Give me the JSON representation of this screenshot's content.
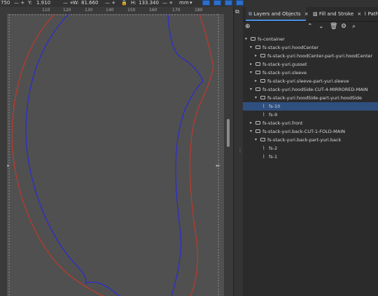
{
  "toolbar": {
    "x_fragment": "750",
    "y_label": "Y:",
    "y_value": "1.910",
    "w_label": "W:",
    "w_value": "81.660",
    "h_label": "H:",
    "h_value": "133.340",
    "unit": "mm"
  },
  "ruler": {
    "ticks": [
      "110",
      "120",
      "130",
      "140",
      "150",
      "160",
      "170",
      "180"
    ]
  },
  "panel": {
    "tabs": [
      {
        "label": "Layers and Objects",
        "close": "×"
      },
      {
        "label": "Fill and Stroke",
        "close": "×"
      },
      {
        "label": "Path"
      }
    ]
  },
  "layers": [
    {
      "label": "fs-container",
      "kind": "folder",
      "caret": "▾"
    },
    {
      "label": "fs-stack-yuri.hoodCenter",
      "kind": "folder",
      "caret": "▾"
    },
    {
      "label": "fs-stack-yuri.hoodCenter-part-yuri.hoodCenter",
      "kind": "folder",
      "caret": "▸"
    },
    {
      "label": "fs-stack-yuri.gusset",
      "kind": "folder",
      "caret": "▸"
    },
    {
      "label": "fs-stack-yuri.sleeve",
      "kind": "folder",
      "caret": "▾"
    },
    {
      "label": "fs-stack-yuri.sleeve-part-yuri.sleeve",
      "kind": "folder",
      "caret": "▸"
    },
    {
      "label": "fs-stack-yuri.hoodSide-CUT-4-MIRRORED-MAIN",
      "kind": "folder",
      "caret": "▾"
    },
    {
      "label": "fs-stack-yuri.hoodSide-part-yuri.hoodSide",
      "kind": "folder",
      "caret": "▾"
    },
    {
      "label": "fs-10",
      "kind": "path",
      "selected": true
    },
    {
      "label": "fs-9",
      "kind": "path"
    },
    {
      "label": "fs-stack-yuri.front",
      "kind": "folder",
      "caret": "▸"
    },
    {
      "label": "fs-stack-yuri.back-CUT-1-FOLD-MAIN",
      "kind": "folder",
      "caret": "▾"
    },
    {
      "label": "fs-stack-yuri.back-part-yuri.back",
      "kind": "folder",
      "caret": "▾"
    },
    {
      "label": "fs-2",
      "kind": "path"
    },
    {
      "label": "fs-1",
      "kind": "path"
    }
  ],
  "colors": {
    "outer_path": "#c0392b",
    "inner_path": "#2a2ad6",
    "selection": "#2f4f7f",
    "toggle_blue": "#2f6fc8"
  }
}
